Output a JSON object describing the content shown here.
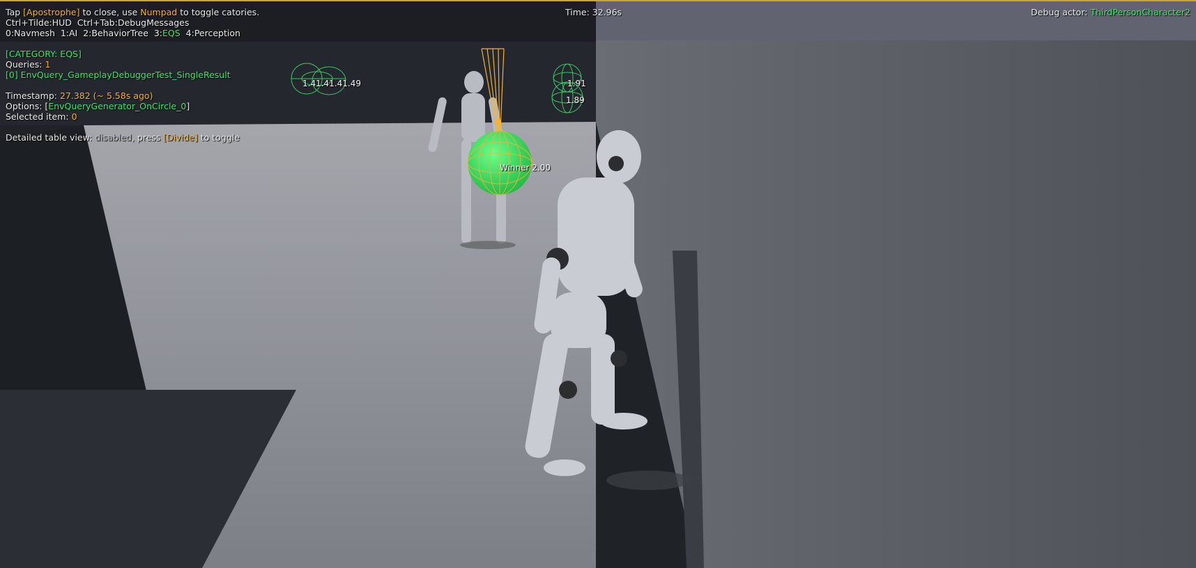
{
  "hud": {
    "line1": {
      "pre": "Tap ",
      "key": "[Apostrophe]",
      "mid": " to close, use ",
      "key2": "Numpad",
      "post": " to toggle catories."
    },
    "line2": "Ctrl+Tilde:HUD  Ctrl+Tab:DebugMessages",
    "categories": {
      "c0": "0:Navmesh",
      "c1": "1:AI",
      "c2": "2:BehaviorTree",
      "c3_num": "3:",
      "c3_name": "EQS",
      "c4": "4:Perception"
    },
    "time_label": "Time: 32.96s",
    "debug_actor_label": "Debug actor: ",
    "debug_actor_name": "ThirdPersonCharacter2"
  },
  "eqs": {
    "category": "[CATEGORY: EQS]",
    "queries_label": "Queries: ",
    "queries_count": "1",
    "query_name": "[0] EnvQuery_GameplayDebuggerTest_SingleResult",
    "timestamp_label": "Timestamp: ",
    "timestamp_value": "27.382 (~ 5.58s ago)",
    "options_label": "Options: ",
    "options_open": "[",
    "options_value": "EnvQueryGenerator_OnCircle_0",
    "options_close": "]",
    "selected_label": "Selected item: ",
    "selected_value": "0",
    "detail_pre": "Detailed table view: ",
    "detail_state": "disabled",
    "detail_mid": ", press ",
    "detail_key": "[Divide]",
    "detail_post": " to toggle"
  },
  "world_labels": {
    "cluster_left": "1.41.41.41.49",
    "score_a": "1.91",
    "score_b": "1.89",
    "winner": "Winner 2.00"
  },
  "colors": {
    "accent_yellow": "#f2b233",
    "accent_green": "#41e36b",
    "floor": "#8e9096",
    "wall": "#5d6068"
  }
}
